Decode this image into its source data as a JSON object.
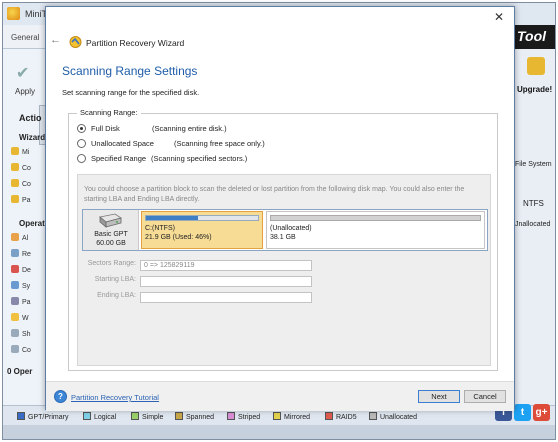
{
  "background_app": {
    "title": "MiniT",
    "tab_general": "General",
    "brand": "Tool",
    "apply_label": "Apply",
    "action_heading": "Actio",
    "wizard_heading": "Wizard",
    "wizard_items": [
      "Mi",
      "Co",
      "Co",
      "Pa"
    ],
    "operations_heading": "Operat",
    "operation_items": [
      "Al",
      "Re",
      "De",
      "Sy",
      "Pa",
      "W",
      "Sh",
      "Co"
    ],
    "pending_ops": "0 Oper",
    "upgrade_label": "Upgrade!",
    "fs_column": "File System",
    "fs_value": "NTFS",
    "unallocated_value": "Jnallocated",
    "legend": [
      {
        "label": "GPT/Primary",
        "color": "#3a6bc4"
      },
      {
        "label": "Logical",
        "color": "#7fd0e8"
      },
      {
        "label": "Simple",
        "color": "#9bd06a"
      },
      {
        "label": "Spanned",
        "color": "#c9a64a"
      },
      {
        "label": "Striped",
        "color": "#d98ed3"
      },
      {
        "label": "Mirrored",
        "color": "#e3d24c"
      },
      {
        "label": "RAID5",
        "color": "#e05a4e"
      },
      {
        "label": "Unallocated",
        "color": "#b9b9b9"
      }
    ],
    "social": [
      {
        "icon": "facebook-icon",
        "glyph": "f",
        "color": "#3b5998"
      },
      {
        "icon": "twitter-icon",
        "glyph": "t",
        "color": "#1da1f2"
      },
      {
        "icon": "google-plus-icon",
        "glyph": "g+",
        "color": "#dd4b39"
      }
    ]
  },
  "dialog": {
    "close_glyph": "✕",
    "back_glyph": "←",
    "wizard_title": "Partition Recovery Wizard",
    "heading": "Scanning Range Settings",
    "subheading": "Set scanning range for the specified disk.",
    "group_label": "Scanning Range:",
    "options": [
      {
        "label": "Full Disk",
        "desc": "(Scanning entire disk.)",
        "checked": true
      },
      {
        "label": "Unallocated Space",
        "desc": "(Scanning free space only.)",
        "checked": false
      },
      {
        "label": "Specified Range",
        "desc": "(Scanning specified sectors.)",
        "checked": false
      }
    ],
    "hint": "You could choose a partition block to scan the deleted or lost partition from the following disk map. You could also enter the starting LBA and Ending LBA directly.",
    "disk": {
      "name": "Basic GPT",
      "size": "60.00 GB"
    },
    "partitions": [
      {
        "name": "C:(NTFS)",
        "detail": "21.9 GB (Used: 46%)",
        "used_fraction": 0.46
      },
      {
        "name": "(Unallocated)",
        "detail": "38.1 GB"
      }
    ],
    "fields": {
      "sectors_range_label": "Sectors Range:",
      "sectors_range_value": "0 => 125829119",
      "starting_lba_label": "Starting LBA:",
      "starting_lba_value": "",
      "ending_lba_label": "Ending LBA:",
      "ending_lba_value": ""
    },
    "footer": {
      "tutorial_link": "Partition Recovery Tutorial",
      "next_label": "Next",
      "cancel_label": "Cancel"
    }
  }
}
